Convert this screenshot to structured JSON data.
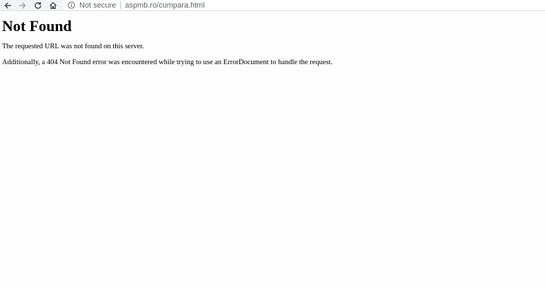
{
  "browser": {
    "security_label": "Not secure",
    "url": "aspmb.ro/cumpara.html",
    "icons": {
      "back": "back-arrow-icon",
      "forward": "forward-arrow-icon",
      "reload": "reload-icon",
      "home": "home-icon",
      "info": "info-icon"
    }
  },
  "page": {
    "title": "Not Found",
    "message": "The requested URL was not found on this server.",
    "additional": "Additionally, a 404 Not Found error was encountered while trying to use an ErrorDocument to handle the request."
  }
}
